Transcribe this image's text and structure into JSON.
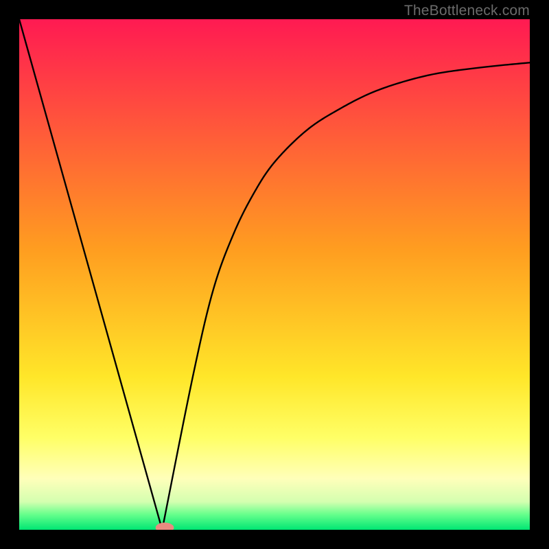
{
  "watermark": "TheBottleneck.com",
  "chart_data": {
    "type": "line",
    "title": "",
    "xlabel": "",
    "ylabel": "",
    "xlim": [
      0,
      1
    ],
    "ylim": [
      0,
      1
    ],
    "grid": false,
    "legend": false,
    "background_gradient": {
      "stops": [
        {
          "pos": 0.0,
          "color": "#ff1a52"
        },
        {
          "pos": 0.45,
          "color": "#ff9d20"
        },
        {
          "pos": 0.7,
          "color": "#ffe629"
        },
        {
          "pos": 0.82,
          "color": "#ffff66"
        },
        {
          "pos": 0.9,
          "color": "#ffffba"
        },
        {
          "pos": 0.945,
          "color": "#d4ffb0"
        },
        {
          "pos": 0.97,
          "color": "#66ff8c"
        },
        {
          "pos": 1.0,
          "color": "#00e673"
        }
      ]
    },
    "curve": {
      "left_branch": {
        "x": [
          0.0,
          0.28
        ],
        "y": [
          1.0,
          0.0
        ],
        "kind": "linear"
      },
      "right_branch": {
        "x": [
          0.28,
          0.34,
          0.38,
          0.42,
          0.46,
          0.5,
          0.56,
          0.62,
          0.7,
          0.8,
          0.9,
          1.0
        ],
        "y": [
          0.0,
          0.3,
          0.47,
          0.58,
          0.66,
          0.72,
          0.78,
          0.82,
          0.86,
          0.89,
          0.905,
          0.915
        ]
      },
      "notch_x": 0.28
    },
    "marker": {
      "x": 0.285,
      "y": 0.0,
      "rx": 0.018,
      "ry": 0.01,
      "color": "#e98b80"
    }
  }
}
